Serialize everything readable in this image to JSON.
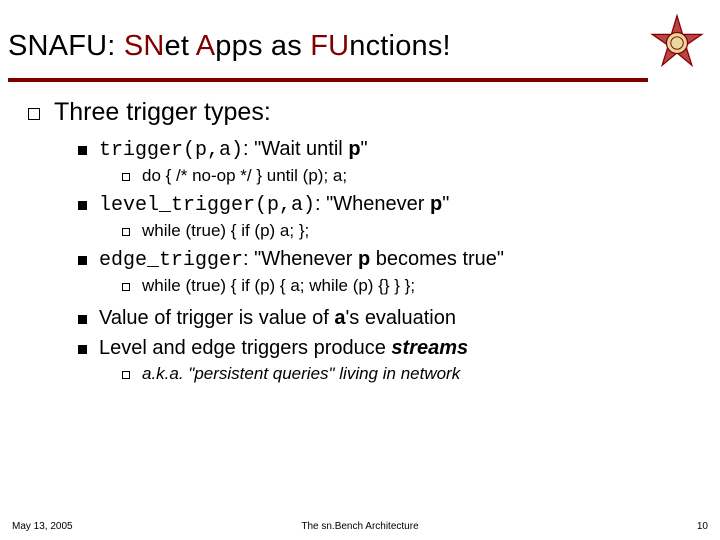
{
  "title": {
    "seg1": "SNAFU: ",
    "seg2": "SN",
    "seg3": "et ",
    "seg4": "A",
    "seg5": "pps as ",
    "seg6": "FU",
    "seg7": "nctions!"
  },
  "heading": "Three trigger types:",
  "items": [
    {
      "code": "trigger(p,a)",
      "label_pre": ": \"Wait until ",
      "label_bold": "p",
      "label_post": "\"",
      "sub": "do { /* no-op */ } until (p); a;"
    },
    {
      "code": "level_trigger(p,a)",
      "label_pre": ": \"Whenever ",
      "label_bold": "p",
      "label_post": "\"",
      "sub": "while (true) { if (p) a; };"
    },
    {
      "code": "edge_trigger",
      "label_pre": ": \"Whenever ",
      "label_bold": "p",
      "label_post": " becomes true\"",
      "sub": "while (true) { if (p) { a; while (p) {} } };"
    }
  ],
  "notes": [
    {
      "pre": "Value of trigger is value of ",
      "bold": "a",
      "post": "'s evaluation"
    },
    {
      "pre": "Level and edge triggers produce ",
      "ital": "streams",
      "post": ""
    }
  ],
  "aka": "a.k.a. \"persistent queries\" living in network",
  "footer": {
    "date": "May 13, 2005",
    "center": "The sn.Bench Architecture",
    "page": "10"
  }
}
